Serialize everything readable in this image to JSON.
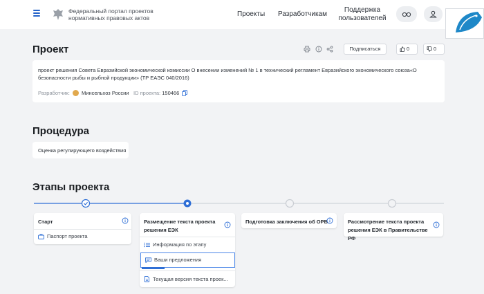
{
  "header": {
    "portal_title": "Федеральный портал проектов нормативных правовых актов",
    "nav": {
      "projects": "Проекты",
      "developers": "Разработчикам",
      "support": "Поддержка пользователей"
    },
    "icons": [
      "menu-icon",
      "emblem-icon",
      "glasses-icon",
      "user-icon"
    ]
  },
  "project": {
    "heading": "Проект",
    "subscribe_label": "Подписаться",
    "likes": "0",
    "dislikes": "0",
    "description": "проект решения Совета Евразийской экономической комиссии О внесении изменений № 1 в технический регламент Евразийского экономического союза«О безопасности рыбы и рыбной продукции» (ТР ЕАЭС 040/2016)",
    "developer_label": "Разработчик:",
    "developer": "Минсельхоз России",
    "id_label": "ID проекта:",
    "id": "150466"
  },
  "procedure": {
    "heading": "Процедура",
    "value": "Оценка регулирующего воздействия"
  },
  "stages": {
    "heading": "Этапы проекта",
    "items": [
      {
        "title": "Старт",
        "status": "done",
        "subitems": [
          "Паспорт проекта"
        ]
      },
      {
        "title": "Размещение текста проекта решения ЕЭК",
        "status": "current",
        "subitems": [
          "Информация по этапу",
          "Ваши предложения",
          "Текущая версия текста проек..."
        ]
      },
      {
        "title": "Подготовка заключения об ОРВ",
        "status": "pending",
        "subitems": []
      },
      {
        "title": "Рассмотрение текста проекта решения ЕЭК в Правительстве РФ",
        "status": "pending",
        "subitems": []
      }
    ]
  },
  "colors": {
    "accent": "#2f6fd6",
    "background": "#f2f3f5",
    "card": "#ffffff"
  }
}
